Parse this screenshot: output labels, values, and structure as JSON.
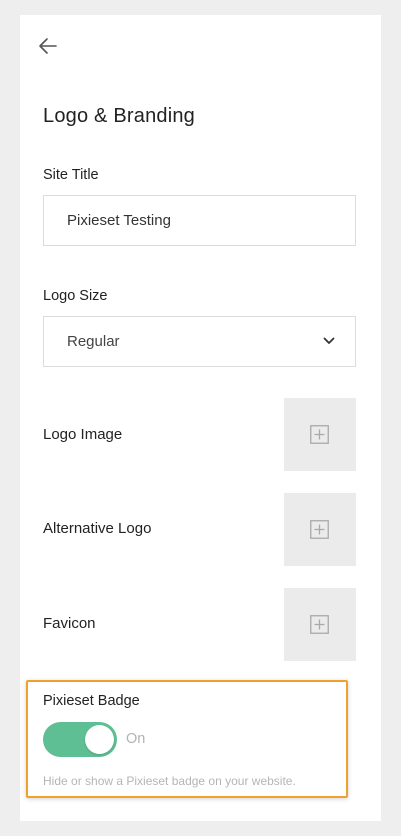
{
  "header": {
    "back_icon": "arrow-left-icon",
    "title": "Logo & Branding"
  },
  "site_title": {
    "label": "Site Title",
    "value": "Pixieset Testing"
  },
  "logo_size": {
    "label": "Logo Size",
    "selected": "Regular",
    "icon": "chevron-down-icon"
  },
  "uploads": [
    {
      "label": "Logo Image",
      "icon": "plus-square-icon"
    },
    {
      "label": "Alternative Logo",
      "icon": "plus-square-icon"
    },
    {
      "label": "Favicon",
      "icon": "plus-square-icon"
    }
  ],
  "badge": {
    "label": "Pixieset Badge",
    "toggle_on": true,
    "toggle_state": "On",
    "help": "Hide or show a Pixieset badge on your website."
  },
  "colors": {
    "toggle_on": "#5dbf93",
    "highlight": "#f0a030",
    "page_bg": "#eeeeee"
  }
}
